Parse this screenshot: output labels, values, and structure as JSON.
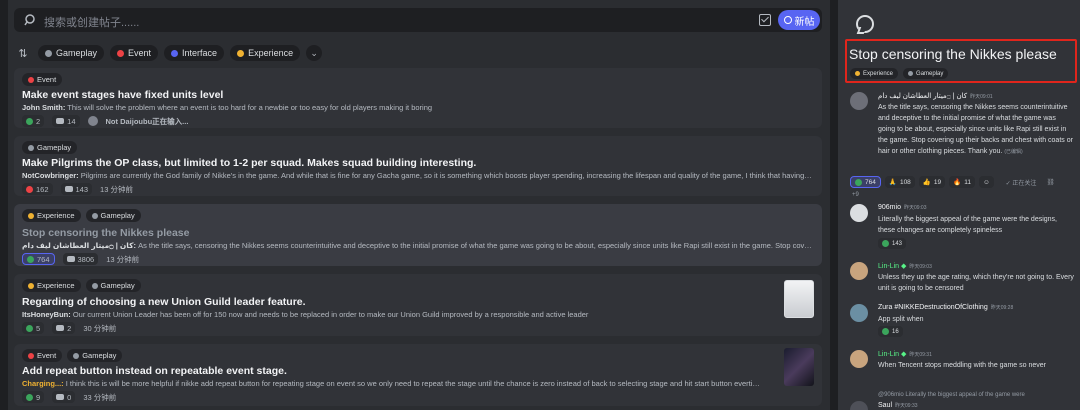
{
  "search": {
    "placeholder": "搜索或创建帖子......",
    "new_label": "新帖"
  },
  "filters": {
    "sort_icon": "sort-icon",
    "chips": [
      {
        "label": "Gameplay",
        "color": "#949ba4"
      },
      {
        "label": "Event",
        "color": "#ed4245"
      },
      {
        "label": "Interface",
        "color": "#5865f2"
      },
      {
        "label": "Experience",
        "color": "#f0b232"
      }
    ]
  },
  "posts": [
    {
      "tags": [
        "Event"
      ],
      "title": "Make event stages have fixed units level",
      "author": "John Smith:",
      "excerpt": " This will solve the problem where an event is too hard for a newbie or too easy for old players making it boring",
      "reactions": "2",
      "comments": "14",
      "extra": "Not Daijoubu正在输入..."
    },
    {
      "tags": [
        "Gameplay"
      ],
      "title": "Make Pilgrims the OP class, but limited to 1-2 per squad. Makes squad building interesting.",
      "author": "NotCowbringer:",
      "excerpt": " Pilgrims are currently the God family of Nikke's in the game. And while that is fine for any Gacha game, so it is something which boosts player spending, increasing the lifespan and quality of the game, I think that having them being no-brainer additions to ...",
      "reactions": "162",
      "comments": "143",
      "time": "13 分钟前"
    },
    {
      "tags": [
        "Experience",
        "Gameplay"
      ],
      "title": "Stop censoring the Nikkes please",
      "author": "كان | ۝ميتار العطاشان ليف دام:",
      "excerpt": " As the title says, censoring the Nikkes seems counterintuitive and deceptive to the initial promise of what the game was going to be about, especially since units like Rapi still exist in the game. Stop covering up their backs and chest with coats or h...",
      "reactions": "764",
      "comments": "3806",
      "time": "13 分钟前"
    },
    {
      "tags": [
        "Experience",
        "Gameplay"
      ],
      "title": "Regarding of choosing a new Union Guild leader feature.",
      "author": "ItsHoneyBun:",
      "excerpt": " Our current Union Leader has been off for 150 now and needs to be replaced in order to make our Union Guild improved by a responsible and active leader",
      "reactions": "5",
      "comments": "2",
      "time": "30 分钟前"
    },
    {
      "tags": [
        "Event",
        "Gameplay"
      ],
      "title": "Add repeat button instead on repeatable event stage.",
      "author": "Charging...:",
      "excerpt": " I think this is will be more helpful if nikke add repeat button for repeating stage on event so we only need to repeat the stage until the chance is zero instead of back to selecting stage and hit start button evertime and waste time on loading t...",
      "reactions": "9",
      "comments": "0",
      "time": "33 分钟前"
    }
  ],
  "thread": {
    "title": "Stop censoring the Nikkes please",
    "tags": [
      "Experience",
      "Gameplay"
    ],
    "op": {
      "name": "كان | ۝ميتار العطاشان ليف دام",
      "time": "昨天09:01",
      "body": "As the title says, censoring the Nikkes seems counterintuitive and deceptive to the initial promise of what the game was going to be about, especially since units like Rapi still exist in the game. Stop covering up their backs and chest with coats or hair or other clothing pieces. Thank you.",
      "edited": "(已编辑)",
      "reactions": [
        "764",
        "108",
        "19",
        "11"
      ],
      "follow": "正在关注",
      "more": "+9"
    },
    "replies": [
      {
        "name": "906mio",
        "time": "昨天09:03",
        "body": "Literally the biggest appeal of the game were the designs, these changes are completely spineless",
        "react": "143"
      },
      {
        "name": "Lin-Lin",
        "time": "昨天09:03",
        "body": "Unless they up the age rating, which they're not going to. Every unit is going to be censored",
        "react": ""
      },
      {
        "name": "Zura #NIKKEDestructionOfClothing",
        "time": "昨天09:28",
        "body": "App split when",
        "react": "16"
      },
      {
        "name": "Lin-Lin",
        "time": "昨天09:31",
        "body": "When Tencent stops meddling with the game so never",
        "react": ""
      },
      {
        "name": "Saul",
        "time": "昨天09:33",
        "body": "",
        "quote": "@906mio Literally the biggest appeal of the game were"
      }
    ]
  }
}
